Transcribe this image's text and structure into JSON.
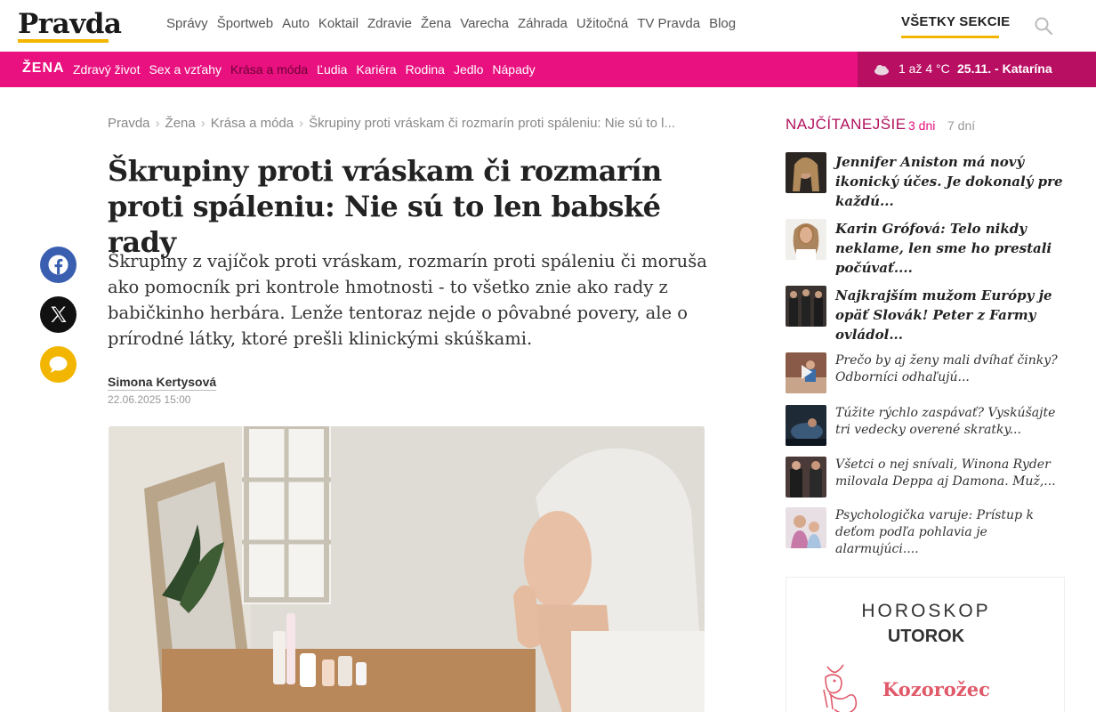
{
  "header": {
    "logo": "Pravda",
    "nav": [
      "Správy",
      "Športweb",
      "Auto",
      "Koktail",
      "Zdravie",
      "Žena",
      "Varecha",
      "Záhrada",
      "Užitočná",
      "TV Pravda",
      "Blog"
    ],
    "all_sections": "VŠETKY SEKCIE",
    "search_icon": "search-icon"
  },
  "section_bar": {
    "name": "ŽENA",
    "items": [
      "Zdravý život",
      "Sex a vzťahy",
      "Krása a móda",
      "Ľudia",
      "Kariéra",
      "Rodina",
      "Jedlo",
      "Nápady"
    ],
    "active_item": "Krása a móda",
    "weather": "1 až 4 °C",
    "date_name": "25.11. - Katarína",
    "color": "#e8117f"
  },
  "breadcrumb": [
    "Pravda",
    "Žena",
    "Krása a móda",
    "Škrupiny proti vráskam či rozmarín proti spáleniu: Nie sú to l..."
  ],
  "article": {
    "title": "Škrupiny proti vráskam či rozmarín proti spáleniu: Nie sú to len babské rady",
    "perex": "Škrupiny z vajíčok proti vráskam, rozmarín proti spáleniu či moruša ako pomocník pri kontrole hmotnosti - to všetko znie ako rady z babičkinho herbára. Lenže tentoraz nejde o pôvabné povery, ale o prírodné látky, ktoré prešli klinickými skúškami.",
    "author": "Simona Kertysová",
    "date": "22.06.2025 15:00"
  },
  "share": [
    "facebook-icon",
    "x-icon",
    "comment-icon"
  ],
  "most_read": {
    "title": "NAJČÍTANEJŠIE",
    "tabs": [
      "3 dni",
      "7 dní"
    ],
    "items": [
      {
        "text": "Jennifer Aniston má nový ikonický účes. Je dokonalý pre každú..."
      },
      {
        "text": "Karin Grófová: Telo nikdy neklame, len sme ho prestali počúvať...."
      },
      {
        "text": "Najkrajším mužom Európy je opäť Slovák! Peter z Farmy ovládol..."
      },
      {
        "text": "Prečo by aj ženy mali dvíhať činky? Odborníci odhaľujú..."
      },
      {
        "text": "Túžite rýchlo zaspávať? Vyskúšajte tri vedecky overené skratky..."
      },
      {
        "text": "Všetci o nej snívali, Winona Ryder milovala Deppa aj Damona. Muž,..."
      },
      {
        "text": "Psychologička varuje: Prístup k deťom podľa pohlavia je alarmujúci...."
      }
    ]
  },
  "horoscope": {
    "title": "HOROSKOP",
    "day": "UTOROK",
    "sign": "Kozorožec"
  }
}
